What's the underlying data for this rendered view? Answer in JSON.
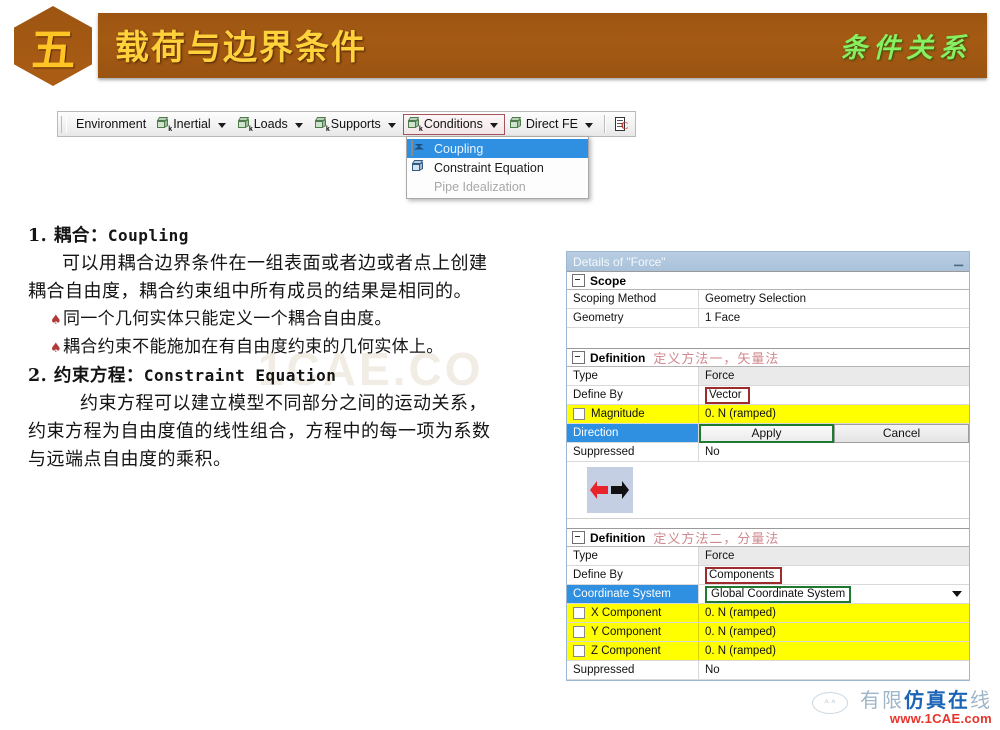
{
  "header": {
    "badge_number": "五",
    "title": "载荷与边界条件",
    "subtitle": "条件关系"
  },
  "toolbar": {
    "items": [
      {
        "label": "Environment",
        "icon": "",
        "caret": false
      },
      {
        "label": "Inertial",
        "icon": "cube-icon",
        "caret": true
      },
      {
        "label": "Loads",
        "icon": "cube-icon",
        "caret": true
      },
      {
        "label": "Supports",
        "icon": "cube-icon",
        "caret": true
      },
      {
        "label": "Conditions",
        "icon": "cube-icon",
        "caret": true
      },
      {
        "label": "Direct FE",
        "icon": "cube-icon",
        "caret": true
      }
    ],
    "active_item": "Conditions",
    "end_icon": "report-icon"
  },
  "dropdown": {
    "items": [
      {
        "label": "Coupling",
        "icon": "coupling-icon",
        "state": "selected"
      },
      {
        "label": "Constraint Equation",
        "icon": "constraint-equation-icon",
        "state": "normal"
      },
      {
        "label": "Pipe Idealization",
        "icon": "pipe-icon",
        "state": "disabled"
      }
    ]
  },
  "content": {
    "item1_heading_cn": "1. 耦合：",
    "item1_heading_en": "Coupling",
    "item1_p1": "可以用耦合边界条件在一组表面或者边或者点上创建",
    "item1_p2": "耦合自由度，耦合约束组中所有成员的结果是相同的。",
    "bullet1": "同一个几何实体只能定义一个耦合自由度。",
    "bullet2": "耦合约束不能施加在有自由度约束的几何实体上。",
    "item2_heading_cn": "2. 约束方程：",
    "item2_heading_en": "Constraint Equation",
    "item2_p1": "约束方程可以建立模型不同部分之间的运动关系，",
    "item2_p2": "约束方程为自由度值的线性组合，方程中的每一项为系数",
    "item2_p3": "与远端点自由度的乘积。",
    "watermark": "1CAE.CO"
  },
  "details": {
    "title": "Details of \"Force\"",
    "pin_icon": "pin-icon",
    "scope": {
      "section_label": "Scope",
      "rows": [
        {
          "key": "Scoping Method",
          "value": "Geometry Selection"
        },
        {
          "key": "Geometry",
          "value": "1 Face"
        }
      ]
    },
    "definition1": {
      "section_label": "Definition",
      "section_note": "定义方法一，矢量法",
      "type_key": "Type",
      "type_value": "Force",
      "define_by_key": "Define By",
      "define_by_value": "Vector",
      "magnitude_key": "Magnitude",
      "magnitude_value": "0. N  (ramped)",
      "direction_key": "Direction",
      "apply_label": "Apply",
      "cancel_label": "Cancel",
      "suppressed_key": "Suppressed",
      "suppressed_value": "No",
      "direction_picture": "left-right-arrows-icon"
    },
    "definition2": {
      "section_label": "Definition",
      "section_note": "定义方法二，分量法",
      "type_key": "Type",
      "type_value": "Force",
      "define_by_key": "Define By",
      "define_by_value": "Components",
      "coordinate_system_key": "Coordinate System",
      "coordinate_system_value": "Global Coordinate System",
      "x_key": "X Component",
      "x_value": "0. N  (ramped)",
      "y_key": "Y Component",
      "y_value": "0. N  (ramped)",
      "z_key": "Z Component",
      "z_value": "0. N  (ramped)",
      "suppressed_key": "Suppressed",
      "suppressed_value": "No"
    }
  },
  "footer": {
    "brand_cn_1": "有限",
    "brand_cn_2": "仿真",
    "brand_cn_3": "在",
    "brand_cn_4": "线",
    "url": "www.1CAE.com",
    "face_icon": "smiley-icon"
  },
  "colors": {
    "header_brown": "#9c5512",
    "header_gold": "#ffd23c",
    "header_green": "#88f060",
    "highlight_yellow": "#ffff00",
    "select_blue": "#2f8fe0",
    "annot_red": "#9c2b2b",
    "annot_green": "#1d7a2f",
    "brand_red": "#e8332a"
  }
}
